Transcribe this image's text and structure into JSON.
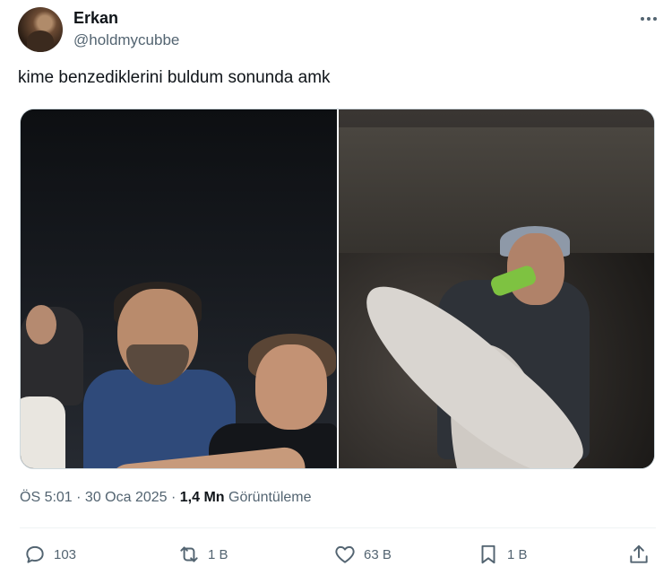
{
  "author": {
    "name": "Erkan",
    "handle": "@holdmycubbe",
    "avatar_icon": "user-avatar"
  },
  "tweet": {
    "text": "kime benzediklerini buldum sonunda amk",
    "timestamp": "ÖS 5:01 · 30 Oca 2025 · ",
    "views_count": "1,4 Mn",
    "views_label": " Görüntüleme"
  },
  "actions": {
    "reply_count": "103",
    "retweet_count": "1 B",
    "like_count": "63 B",
    "bookmark_count": "1 B"
  },
  "colors": {
    "text_primary": "#0f1419",
    "text_secondary": "#536471",
    "border": "#cfd9de"
  },
  "icons": {
    "reply": "reply-icon",
    "retweet": "retweet-icon",
    "like": "heart-icon",
    "bookmark": "bookmark-icon",
    "share": "share-icon",
    "more": "more-icon"
  }
}
